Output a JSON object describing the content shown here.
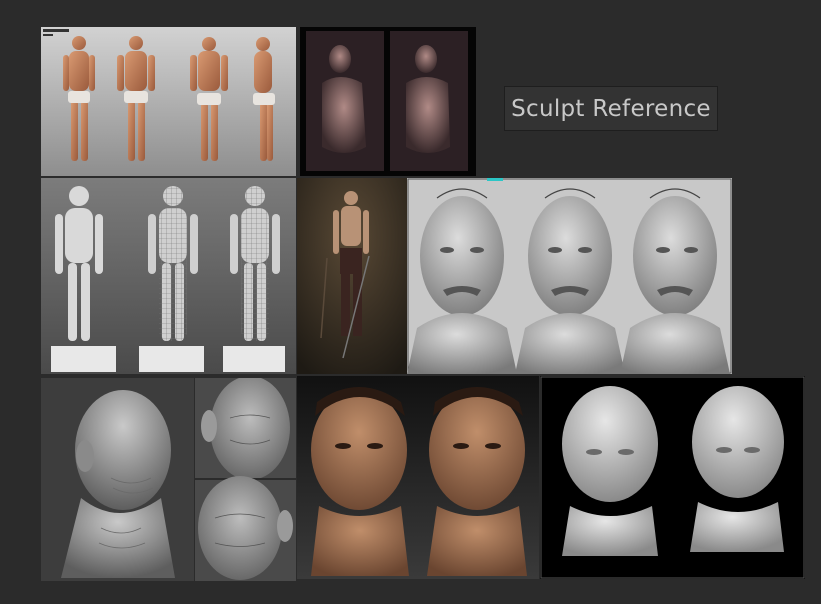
{
  "board": {
    "title": "Sculpt Reference",
    "background": "#2b2b2b"
  },
  "images": [
    {
      "name": "ref-old-man-turnaround-color",
      "subject": "elderly man full body turnaround, colored"
    },
    {
      "name": "ref-old-man-torso-pair",
      "subject": "two lit torso renders on dark background"
    },
    {
      "name": "ref-old-man-wireframe-turnaround",
      "subject": "grey mesh body turnaround with wireframe"
    },
    {
      "name": "ref-warrior-concept",
      "subject": "painted standing warrior with sword"
    },
    {
      "name": "ref-mustache-head-triplet",
      "subject": "three grey sculpted heads with mustache"
    },
    {
      "name": "ref-bald-head-side",
      "subject": "bald wrinkled head side view, grey"
    },
    {
      "name": "ref-wrinkled-face-closeups",
      "subject": "two wrinkled face close-ups, grey"
    },
    {
      "name": "ref-colored-head-pair",
      "subject": "two painted realistic asian old man busts"
    },
    {
      "name": "ref-grey-head-pair",
      "subject": "two grey old man busts on black"
    }
  ],
  "colors": {
    "label_bg": "#333333",
    "label_text": "#c8c8c8",
    "accent": "#2cc6c6"
  }
}
